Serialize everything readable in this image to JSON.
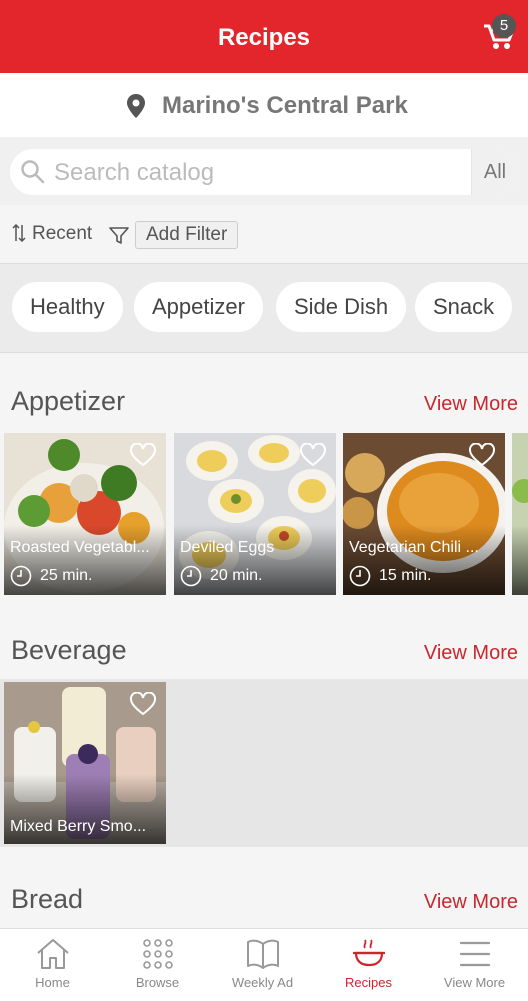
{
  "header": {
    "title": "Recipes",
    "cart_count": "5"
  },
  "store": {
    "name": "Marino's Central Park"
  },
  "search": {
    "placeholder": "Search catalog",
    "scope": "All"
  },
  "sort": {
    "label": "Recent",
    "filter_label": "Add Filter"
  },
  "chips": [
    "Healthy",
    "Appetizer",
    "Side Dish",
    "Snack"
  ],
  "sections": [
    {
      "title": "Appetizer",
      "view_more": "View More",
      "cards": [
        {
          "title": "Roasted Vegetabl...",
          "time": "25 min."
        },
        {
          "title": "Deviled Eggs",
          "time": "20 min."
        },
        {
          "title": "Vegetarian Chili ...",
          "time": "15 min."
        }
      ]
    },
    {
      "title": "Beverage",
      "view_more": "View More",
      "cards": [
        {
          "title": "Mixed Berry Smo..."
        }
      ]
    },
    {
      "title": "Bread",
      "view_more": "View More"
    }
  ],
  "nav": {
    "items": [
      {
        "label": "Home",
        "icon": "home-icon"
      },
      {
        "label": "Browse",
        "icon": "grid-icon"
      },
      {
        "label": "Weekly Ad",
        "icon": "book-icon"
      },
      {
        "label": "Recipes",
        "icon": "pot-icon",
        "active": true
      },
      {
        "label": "View More",
        "icon": "menu-icon"
      }
    ]
  },
  "colors": {
    "brand_red": "#e3262c",
    "link_red": "#c9272e"
  }
}
